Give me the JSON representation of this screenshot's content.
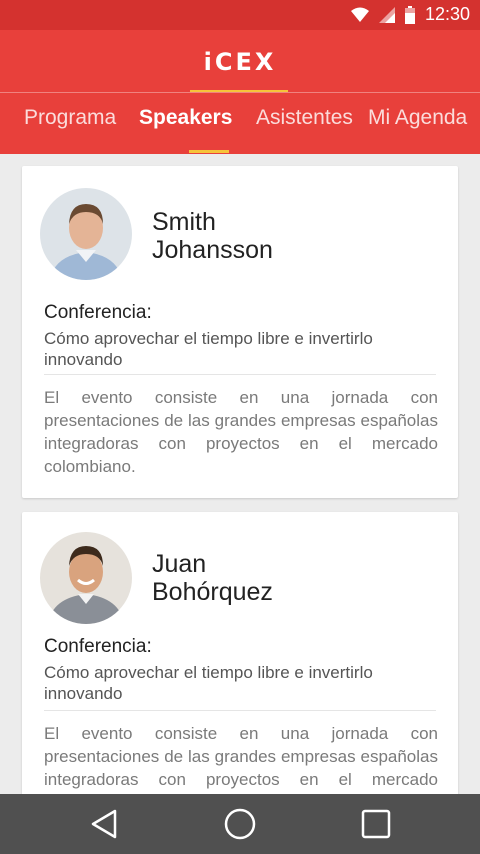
{
  "status_bar": {
    "time": "12:30",
    "icons": [
      "wifi-icon",
      "signal-icon",
      "battery-icon"
    ]
  },
  "header": {
    "logo": "iCEX",
    "tabs": [
      {
        "label": "Programa",
        "active": false
      },
      {
        "label": "Speakers",
        "active": true
      },
      {
        "label": "Asistentes",
        "active": false
      },
      {
        "label": "Mi Agenda",
        "active": false
      }
    ],
    "colors": {
      "primary": "#e8403b",
      "accent": "#f6c43a"
    }
  },
  "speakers": [
    {
      "first_name": "Smith",
      "last_name": "Johansson",
      "conference_label": "Conferencia:",
      "conference_title": "Cómo aprovechar el tiempo libre e invertirlo innovando",
      "description": "El evento consiste en una jornada con presentaciones de las grandes empresas españolas integradoras con proyectos en el mercado colombiano."
    },
    {
      "first_name": "Juan",
      "last_name": "Bohórquez",
      "conference_label": "Conferencia:",
      "conference_title": "Cómo aprovechar el tiempo libre e invertirlo innovando",
      "description": "El evento consiste en una jornada con presentaciones de las grandes empresas españolas integradoras con proyectos en el mercado colombiano."
    }
  ],
  "nav_bar": {
    "buttons": [
      "back-icon",
      "home-icon",
      "recents-icon"
    ]
  }
}
